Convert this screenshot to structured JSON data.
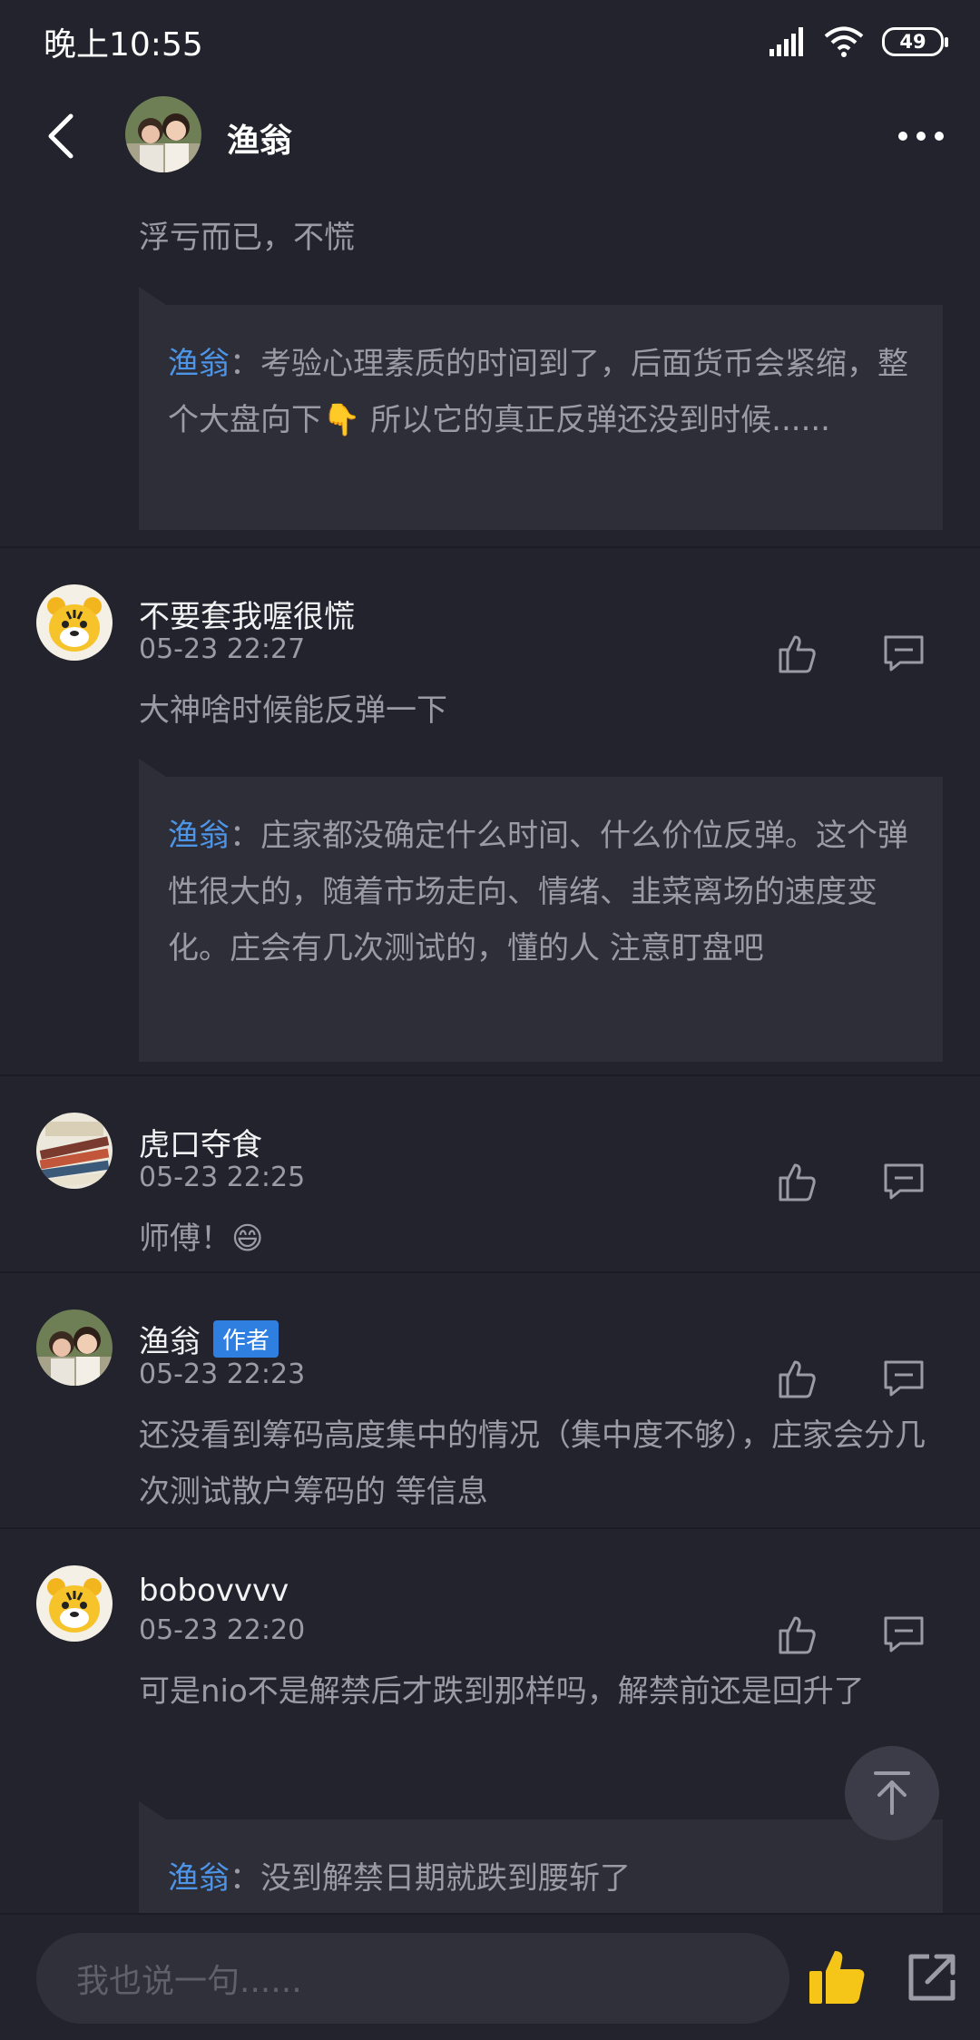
{
  "status_bar": {
    "time": "晚上10:55",
    "battery": "49"
  },
  "header": {
    "title": "渔翁"
  },
  "fragment": {
    "text": "浮亏而已，不慌",
    "reply": {
      "author": "渔翁",
      "separator": "：",
      "text": "考验心理素质的时间到了，后面货币会紧缩，整个大盘向下👇 所以它的真正反弹还没到时候......"
    }
  },
  "comments": [
    {
      "name": "不要套我喔很慌",
      "time": "05-23 22:27",
      "text": "大神啥时候能反弹一下",
      "reply": {
        "author": "渔翁",
        "separator": "：",
        "text": "庄家都没确定什么时间、什么价位反弹。这个弹性很大的，随着市场走向、情绪、韭菜离场的速度变化。庄会有几次测试的，懂的人 注意盯盘吧"
      }
    },
    {
      "name": "虎口夺食",
      "time": "05-23 22:25",
      "text": "师傅！😄"
    },
    {
      "name": "渔翁",
      "tag": "作者",
      "time": "05-23 22:23",
      "text": "还没看到筹码高度集中的情况（集中度不够），庄家会分几次测试散户筹码的 等信息"
    },
    {
      "name": "bobovvvv",
      "time": "05-23 22:20",
      "text": "可是nio不是解禁后才跌到那样吗，解禁前还是回升了",
      "reply": {
        "author": "渔翁",
        "separator": "：",
        "text": "没到解禁日期就跌到腰斩了"
      }
    }
  ],
  "input": {
    "placeholder": "我也说一句......"
  },
  "colors": {
    "background": "#22232c",
    "reply_bg": "#2d2e38",
    "accent_blue": "#4e95e8",
    "thumb_yellow": "#f5c518",
    "author_tag": "#2f7fe0"
  }
}
